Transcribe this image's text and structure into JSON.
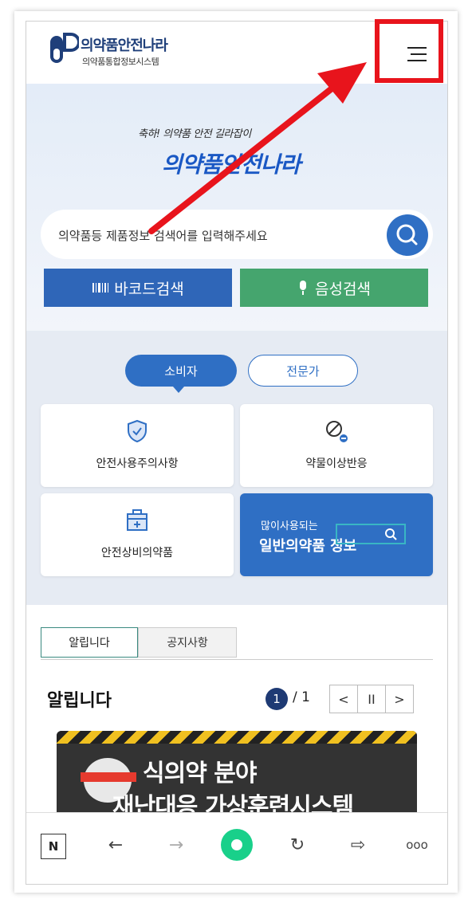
{
  "header": {
    "logo_title": "의약품안전나라",
    "logo_subtitle": "의약품통합정보시스템"
  },
  "hero": {
    "slogan": "축하! 의약품 안전 길라잡이",
    "brand": "의약품안전나라",
    "search_placeholder": "의약품등 제품정보 검색어를 입력해주세요",
    "barcode_label": "바코드검색",
    "voice_label": "음성검색"
  },
  "audience": {
    "consumer_label": "소비자",
    "expert_label": "전문가"
  },
  "cards": [
    {
      "label": "안전사용주의사항",
      "icon": "shield-check-icon"
    },
    {
      "label": "약물이상반응",
      "icon": "pill-warning-icon"
    },
    {
      "label": "안전상비의약품",
      "icon": "first-aid-kit-icon"
    },
    {
      "small": "많이사용되는",
      "big": "일반의약품 정보",
      "icon": "search-icon"
    }
  ],
  "notice": {
    "tab_notice": "알립니다",
    "tab_announcements": "공지사항",
    "title": "알립니다",
    "page_current": "1",
    "page_total": "/ 1",
    "prev": "<",
    "pause": "II",
    "next": ">",
    "banner_line1": "식의약 분야",
    "banner_line2": "재난대응 가상훈련시스템"
  },
  "navbar": {
    "n_label": "N",
    "back": "←",
    "forward": "→",
    "refresh": "↻",
    "share": "⇨",
    "more": "ooo"
  },
  "colors": {
    "primary": "#2f6fc4",
    "voice": "#45a56e",
    "annotation": "#e8141c",
    "home": "#19d08a"
  }
}
